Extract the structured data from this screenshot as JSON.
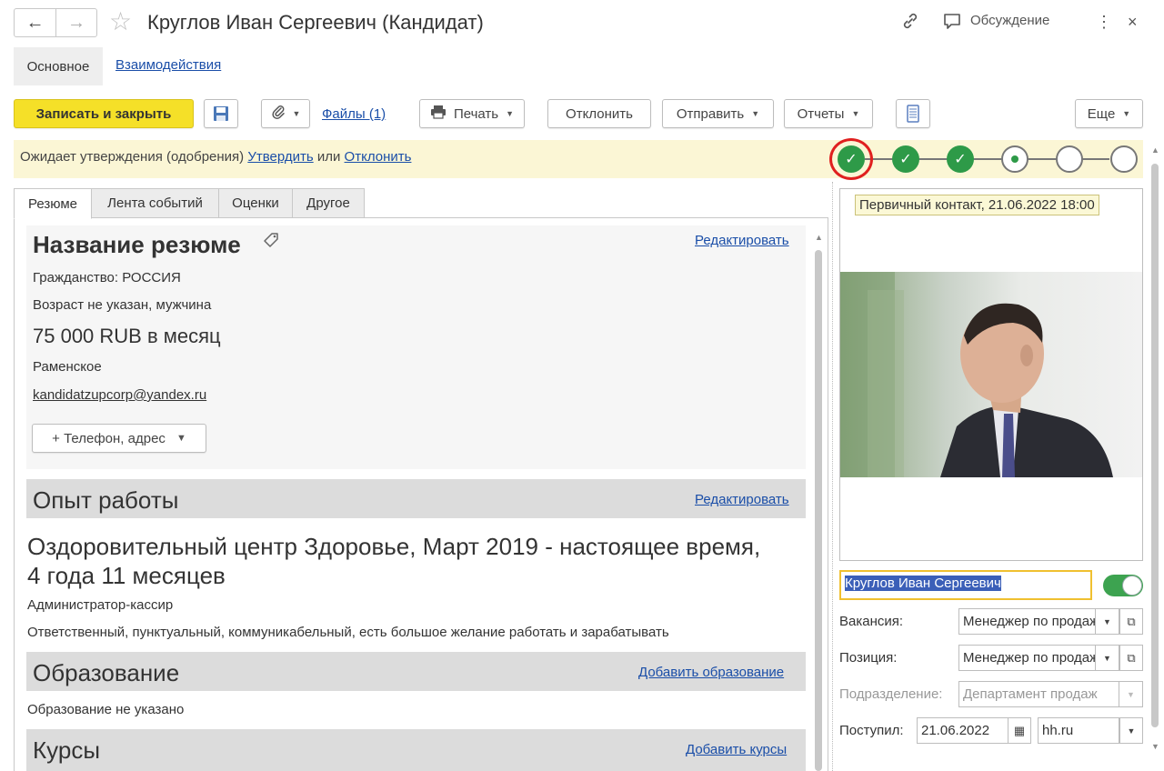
{
  "header": {
    "title": "Круглов Иван Сергеевич (Кандидат)",
    "discussion_label": "Обсуждение"
  },
  "section_tabs": {
    "main": "Основное",
    "interactions": "Взаимодействия"
  },
  "toolbar": {
    "save_close": "Записать и закрыть",
    "files": "Файлы (1)",
    "print": "Печать",
    "reject": "Отклонить",
    "send": "Отправить",
    "reports": "Отчеты",
    "more": "Еще"
  },
  "status": {
    "text": "Ожидает утверждения (одобрения)",
    "approve_link": "Утвердить",
    "or_text": "или",
    "reject_link": "Отклонить",
    "steps": [
      "done",
      "done",
      "done",
      "current",
      "empty",
      "empty"
    ]
  },
  "content_tabs": [
    "Резюме",
    "Лента событий",
    "Оценки",
    "Другое"
  ],
  "resume": {
    "title": "Название резюме",
    "edit_link": "Редактировать",
    "citizenship": "Гражданство: РОССИЯ",
    "age_gender": "Возраст не указан, мужчина",
    "salary": "75 000 RUB в месяц",
    "city": "Раменское",
    "email": "kandidatzupcorp@yandex.ru",
    "phone_button": "+ Телефон, адрес"
  },
  "experience": {
    "title": "Опыт работы",
    "edit_link": "Редактировать",
    "job_line1": "Оздоровительный центр Здоровье, Март 2019 - настоящее время,",
    "job_line2": "4 года 11 месяцев",
    "position": "Администратор-кассир",
    "description": "Ответственный, пунктуальный, коммуникабельный, есть большое желание работать и зарабатывать"
  },
  "education": {
    "title": "Образование",
    "add_link": "Добавить образование",
    "empty_text": "Образование не указано"
  },
  "courses": {
    "title": "Курсы",
    "add_link": "Добавить курсы"
  },
  "photo": {
    "tooltip": "Первичный контакт, 21.06.2022 18:00"
  },
  "candidate": {
    "name": "Круглов Иван Сергеевич",
    "vacancy_label": "Вакансия:",
    "vacancy_value": "Менеджер по продажам",
    "position_label": "Позиция:",
    "position_value": "Менеджер по продажам",
    "department_label": "Подразделение:",
    "department_value": "Департамент продаж",
    "received_label": "Поступил:",
    "received_date": "21.06.2022",
    "source": "hh.ru"
  },
  "colors": {
    "primary_button": "#f5e028",
    "status_bg": "#fbf6d5",
    "step_done": "#2e9a48",
    "highlight_ring": "#e0201f",
    "link": "#1a4ea8"
  }
}
